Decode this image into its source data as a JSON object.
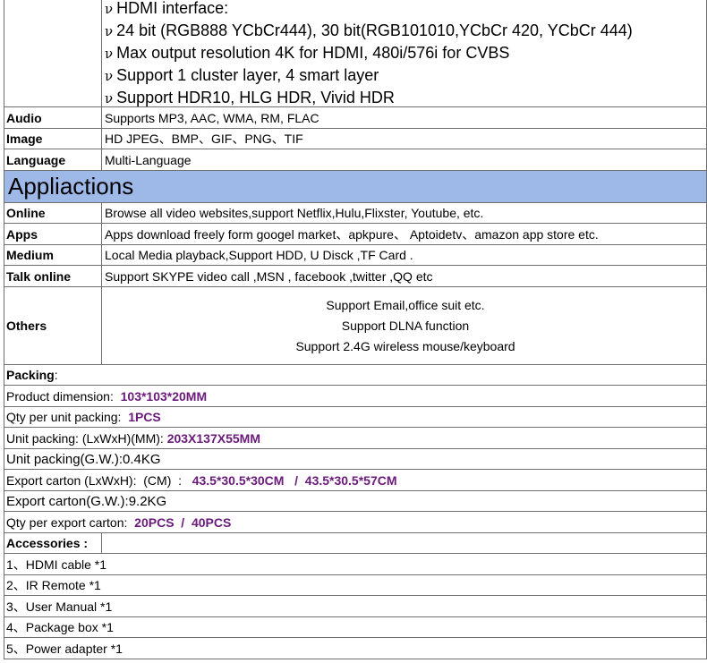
{
  "hdmi_lines": [
    "HDMI interface:",
    "24 bit (RGB888 YCbCr444), 30 bit(RGB101010,YCbCr 420, YCbCr 444)",
    "Max output resolution 4K for HDMI, 480i/576i for CVBS",
    "Support 1 cluster layer, 4 smart layer",
    "Support HDR10, HLG HDR, Vivid HDR"
  ],
  "bullet_char": "ν",
  "specs": [
    {
      "label": "Audio",
      "value": "Supports MP3, AAC, WMA, RM, FLAC"
    },
    {
      "label": "Image",
      "value": "HD JPEG、BMP、GIF、PNG、TIF"
    },
    {
      "label": "Language",
      "value": "Multi-Language"
    }
  ],
  "applications_heading": "Appliactions",
  "applications": [
    {
      "label": "Online",
      "value": "Browse all video websites,support Netflix,Hulu,Flixster, Youtube, etc."
    },
    {
      "label": "Apps",
      "value": "Apps download freely form googel market、apkpure、 Aptoidetv、amazon app store etc."
    },
    {
      "label": "Medium",
      "value": "Local Media playback,Support HDD, U Disck ,TF Card ."
    },
    {
      "label": "Talk online",
      "value": "Support  SKYPE video  call ,MSN , facebook ,twitter ,QQ  etc"
    }
  ],
  "others": {
    "label": "Others",
    "lines": [
      "Support Email,office suit etc.",
      "Support DLNA function",
      "Support 2.4G wireless mouse/keyboard"
    ]
  },
  "packing": {
    "title": "Packing",
    "title_suffix": ":",
    "items": [
      {
        "label": "Product dimension:  ",
        "value": "103*103*20MM"
      },
      {
        "label": "Qty per unit packing:  ",
        "value": "1PCS"
      },
      {
        "label": "Unit packing: (LxWxH)(MM): ",
        "value": "203X137X55MM"
      },
      {
        "label": "Unit packing(G.W.):0.4KG",
        "value": ""
      },
      {
        "label": "Export carton (LxWxH):  (CM)  :   ",
        "value": "43.5*30.5*30CM   /  43.5*30.5*57CM"
      },
      {
        "label": "Export carton(G.W.):9.2KG",
        "value": ""
      },
      {
        "label": "Qty per export carton:  ",
        "value": "20PCS  /  40PCS"
      }
    ]
  },
  "accessories": {
    "title": "Accessories :",
    "items": [
      "1、HDMI cable  *1",
      "2、IR Remote *1",
      "3、User Manual *1",
      "4、Package box  *1",
      "5、Power adapter  *1"
    ]
  }
}
